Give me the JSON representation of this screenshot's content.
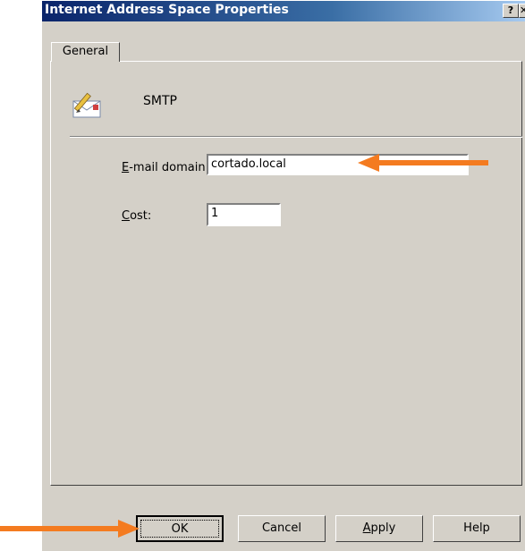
{
  "window": {
    "title": "Internet Address Space Properties",
    "help_glyph": "?",
    "close_glyph": "✕"
  },
  "tabs": [
    {
      "label": "General"
    }
  ],
  "header": {
    "name": "SMTP",
    "icon": "envelope-pencil-icon"
  },
  "fields": {
    "email_domain": {
      "label_mnemonic": "E",
      "label_rest": "-mail domain:",
      "value": "cortado.local"
    },
    "cost": {
      "label_mnemonic": "C",
      "label_rest": "ost:",
      "value": "1"
    }
  },
  "buttons": {
    "ok": "OK",
    "cancel": "Cancel",
    "apply_mnemonic": "A",
    "apply_rest": "pply",
    "help": "Help"
  },
  "colors": {
    "annotation_arrow": "#f47b20",
    "dialog_bg": "#d4d0c8",
    "title_bar": "#0a246a"
  }
}
